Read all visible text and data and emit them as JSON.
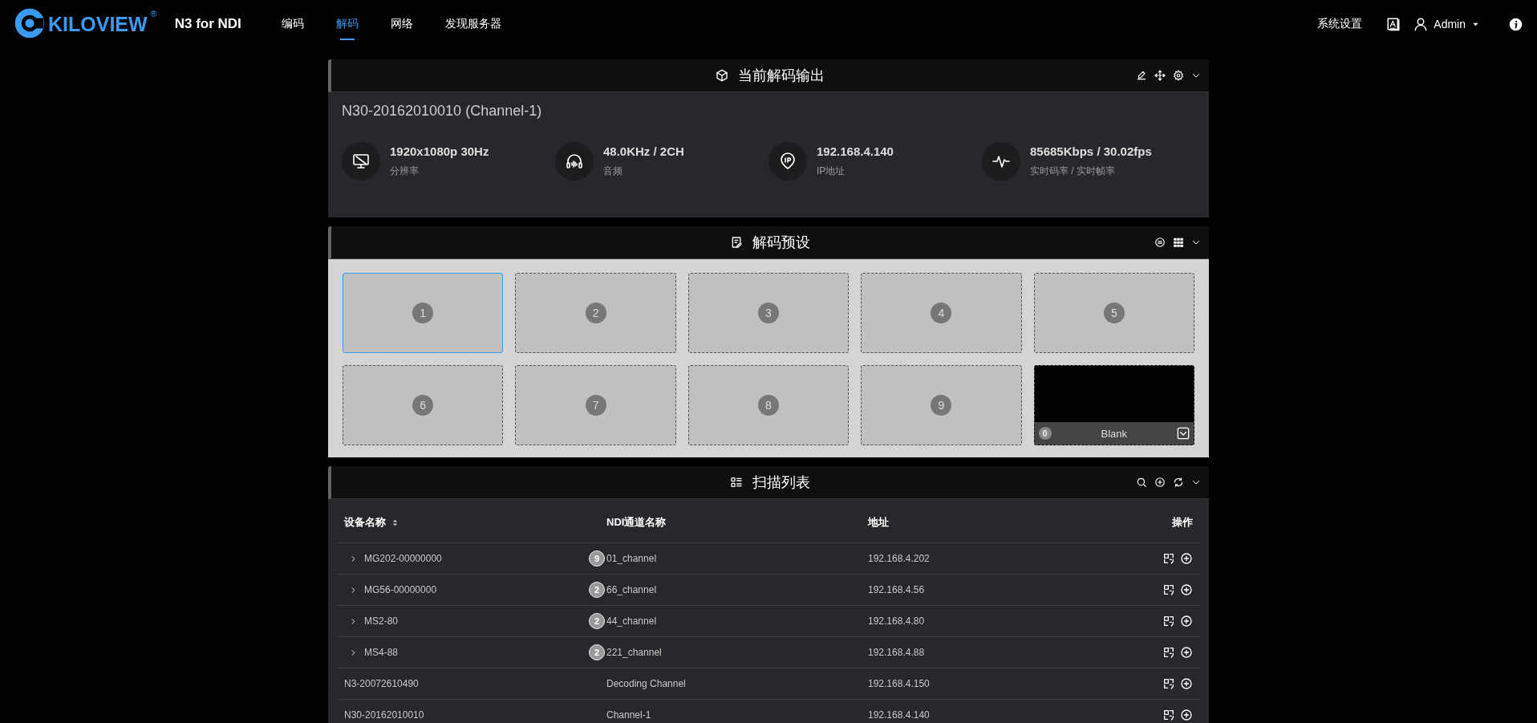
{
  "header": {
    "logo": "KILOVIEW",
    "logo_mark": "®",
    "product": "N3 for NDI",
    "nav": [
      {
        "label": "编码",
        "selected": false
      },
      {
        "label": "解码",
        "selected": true
      },
      {
        "label": "网络",
        "selected": false
      },
      {
        "label": "发现服务器",
        "selected": false
      }
    ],
    "settings": "系统设置",
    "user": "Admin"
  },
  "output_panel": {
    "title": "当前解码输出",
    "source": "N30-20162010010 (Channel-1)",
    "stats": [
      {
        "kind": "resolution",
        "value": "1920x1080p 30Hz",
        "label": "分辨率"
      },
      {
        "kind": "audio",
        "value": "48.0KHz / 2CH",
        "label": "音频"
      },
      {
        "kind": "ip",
        "value": "192.168.4.140",
        "label": "IP地址"
      },
      {
        "kind": "rate",
        "value": "85685Kbps / 30.02fps",
        "label": "实时码率 / 实时帧率"
      }
    ]
  },
  "preset_panel": {
    "title": "解码预设",
    "presets": [
      {
        "kind": "empty",
        "number": "1",
        "selected": true
      },
      {
        "kind": "empty",
        "number": "2",
        "selected": false
      },
      {
        "kind": "empty",
        "number": "3",
        "selected": false
      },
      {
        "kind": "empty",
        "number": "4",
        "selected": false
      },
      {
        "kind": "empty",
        "number": "5",
        "selected": false
      },
      {
        "kind": "empty",
        "number": "6",
        "selected": false
      },
      {
        "kind": "empty",
        "number": "7",
        "selected": false
      },
      {
        "kind": "empty",
        "number": "8",
        "selected": false
      },
      {
        "kind": "empty",
        "number": "9",
        "selected": false
      },
      {
        "kind": "source",
        "number": "0",
        "label": "Blank",
        "selected": false
      }
    ]
  },
  "scan_panel": {
    "title": "扫描列表",
    "columns": [
      "设备名称",
      "NDI通道名称",
      "地址",
      "操作"
    ],
    "rows": [
      {
        "device": "MG202-00000000",
        "expandable": true,
        "count": "9",
        "channel": "01_channel",
        "address": "192.168.4.202"
      },
      {
        "device": "MG56-00000000",
        "expandable": true,
        "count": "2",
        "channel": "66_channel",
        "address": "192.168.4.56"
      },
      {
        "device": "MS2-80",
        "expandable": true,
        "count": "2",
        "channel": "44_channel",
        "address": "192.168.4.80"
      },
      {
        "device": "MS4-88",
        "expandable": true,
        "count": "2",
        "channel": "221_channel",
        "address": "192.168.4.88"
      },
      {
        "device": "N3-20072610490",
        "expandable": false,
        "channel": "Decoding Channel",
        "address": "192.168.4.150"
      },
      {
        "device": "N30-20162010010",
        "expandable": false,
        "channel": "Channel-1",
        "address": "192.168.4.140"
      }
    ]
  }
}
